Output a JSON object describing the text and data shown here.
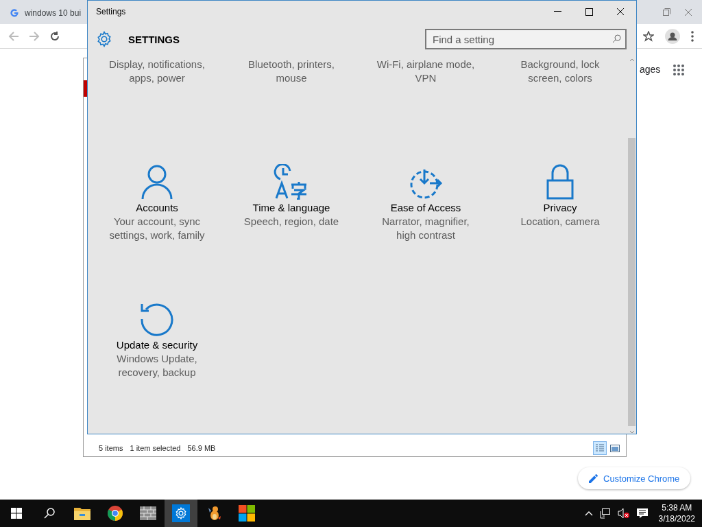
{
  "browser": {
    "tab": {
      "title": "windows 10 bui"
    },
    "page_text": "ages",
    "customize_button": "Customize Chrome"
  },
  "explorer": {
    "status_bar": {
      "items": "5 items",
      "selection": "1 item selected",
      "size": "56.9 MB"
    },
    "views": [
      {
        "kind": "details",
        "selected": true
      },
      {
        "kind": "thumbnails",
        "selected": false
      }
    ]
  },
  "settings": {
    "window_title": "Settings",
    "heading": "SETTINGS",
    "search": {
      "placeholder": "Find a setting"
    },
    "categories": [
      {
        "description": "Display, notifications, apps, power"
      },
      {
        "description": "Bluetooth, printers, mouse"
      },
      {
        "description": "Wi-Fi, airplane mode, VPN"
      },
      {
        "description": "Background, lock screen, colors"
      },
      {
        "kind": "accounts",
        "title": "Accounts",
        "description": "Your account, sync settings, work, family"
      },
      {
        "kind": "time-language",
        "title": "Time & language",
        "description": "Speech, region, date"
      },
      {
        "kind": "ease-of-access",
        "title": "Ease of Access",
        "description": "Narrator, magnifier, high contrast"
      },
      {
        "kind": "privacy",
        "title": "Privacy",
        "description": "Location, camera"
      },
      {
        "kind": "update",
        "title": "Update & security",
        "description": "Windows Update, recovery, backup"
      }
    ]
  },
  "taskbar": {
    "apps": [
      {
        "kind": "folder",
        "selected": false
      },
      {
        "kind": "chrome",
        "selected": false
      },
      {
        "kind": "wall",
        "selected": false
      },
      {
        "kind": "settings",
        "selected": true
      },
      {
        "kind": "creature",
        "selected": false
      },
      {
        "kind": "store",
        "selected": false
      }
    ],
    "time": "5:38 AM",
    "date": "3/18/2022"
  }
}
